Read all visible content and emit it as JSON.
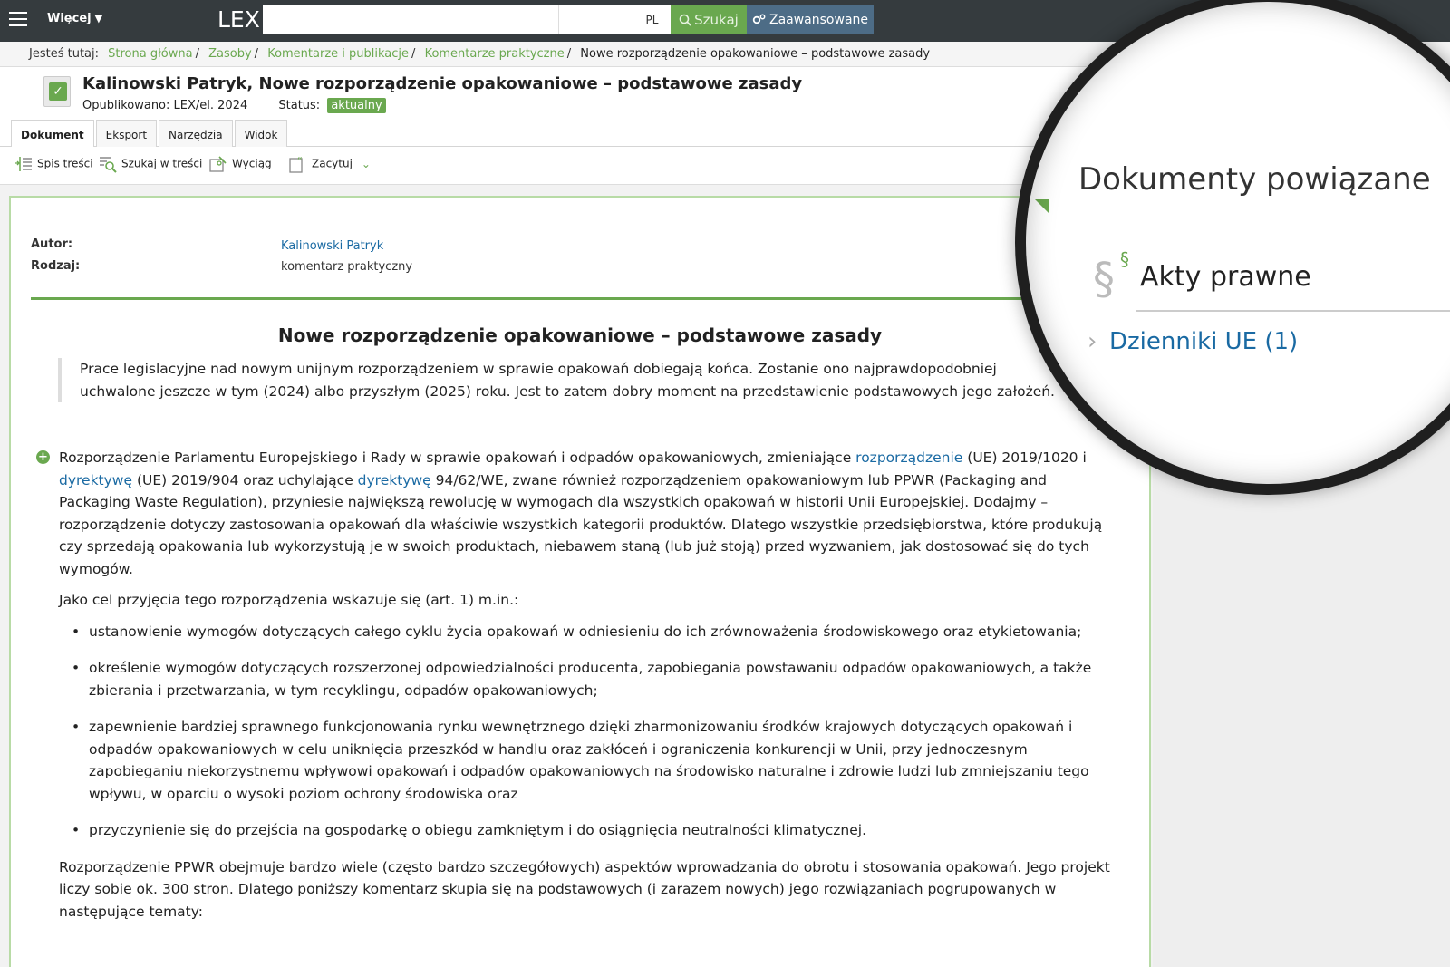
{
  "topbar": {
    "more_label": "Więcej",
    "logo": "LEX",
    "search_placeholder": "",
    "lang": "PL",
    "search_button": "Szukaj",
    "advanced_button": "Zaawansowane"
  },
  "breadcrumb": {
    "label": "Jesteś tutaj:",
    "items": [
      "Strona główna",
      "Zasoby",
      "Komentarze i publikacje",
      "Komentarze praktyczne"
    ],
    "current": "Nowe rozporządzenie opakowaniowe – podstawowe zasady"
  },
  "document": {
    "title": "Kalinowski Patryk, Nowe rozporządzenie opakowaniowe – podstawowe zasady",
    "published_label": "Opublikowano:",
    "published_value": "LEX/el. 2024",
    "status_label": "Status:",
    "status_value": "aktualny"
  },
  "tabs": [
    "Dokument",
    "Eksport",
    "Narzędzia",
    "Widok"
  ],
  "toolbar": {
    "toc": "Spis treści",
    "find": "Szukaj w treści",
    "extract": "Wyciąg",
    "cite": "Zacytuj"
  },
  "meta": {
    "author_label": "Autor:",
    "author_value": "Kalinowski Patryk",
    "type_label": "Rodzaj:",
    "type_value": "komentarz praktyczny"
  },
  "article": {
    "title": "Nowe rozporządzenie opakowaniowe – podstawowe zasady",
    "lead": "Prace legislacyjne nad nowym unijnym rozporządzeniem w sprawie opakowań dobiegają końca. Zostanie ono najprawdopodobniej uchwalone jeszcze w tym (2024) albo przyszłym (2025) roku. Jest to zatem dobry moment na przedstawienie podstawowych jego założeń.",
    "p1_a": "Rozporządzenie Parlamentu Europejskiego i Rady w sprawie opakowań i odpadów opakowaniowych, zmieniające ",
    "p1_link1": "rozporządzenie",
    "p1_b": " (UE) 2019/1020 i ",
    "p1_link2": "dyrektywę",
    "p1_c": " (UE) 2019/904 oraz uchylające ",
    "p1_link3": "dyrektywę",
    "p1_d": " 94/62/WE, zwane również rozporządzeniem opakowaniowym lub PPWR (Packaging and Packaging Waste Regulation), przyniesie największą rewolucję w wymogach dla wszystkich opakowań w historii Unii Europejskiej. Dodajmy – rozporządzenie dotyczy zastosowania opakowań dla właściwie wszystkich kategorii produktów. Dlatego wszystkie przedsiębiorstwa, które produkują czy sprzedają opakowania lub wykorzystują je w swoich produktach, niebawem staną (lub już stoją) przed wyzwaniem, jak dostosować się do tych wymogów.",
    "p2": "Jako cel przyjęcia tego rozporządzenia wskazuje się (art. 1) m.in.:",
    "bullets": [
      "ustanowienie wymogów dotyczących całego cyklu życia opakowań w odniesieniu do ich zrównoważenia środowiskowego oraz etykietowania;",
      "określenie wymogów dotyczących rozszerzonej odpowiedzialności producenta, zapobiegania powstawaniu odpadów opakowaniowych, a także zbierania i przetwarzania, w tym recyklingu, odpadów opakowaniowych;",
      "zapewnienie bardziej sprawnego funkcjonowania rynku wewnętrznego dzięki zharmonizowaniu środków krajowych dotyczących opakowań i odpadów opakowaniowych w celu uniknięcia przeszkód w handlu oraz zakłóceń i ograniczenia konkurencji w Unii, przy jednoczesnym zapobieganiu niekorzystnemu wpływowi opakowań i odpadów opakowaniowych na środowisko naturalne i zdrowie ludzi lub zmniejszaniu tego wpływu, w oparciu o wysoki poziom ochrony środowiska oraz",
      "przyczynienie się do przejścia na gospodarkę o obiegu zamkniętym i do osiągnięcia neutralności klimatycznej."
    ],
    "p3": "Rozporządzenie PPWR obejmuje bardzo wiele (często bardzo szczegółowych) aspektów wprowadzania do obrotu i stosowania opakowań. Jego projekt liczy sobie ok. 300 stron. Dlatego poniższy komentarz skupia się na podstawowych (i zarazem nowych) jego rozwiązaniach pogrupowanych w następujące tematy:"
  },
  "related": {
    "title": "Dokumenty powiązane",
    "section": "Akty prawne",
    "link": "Dzienniki UE (1)"
  },
  "colors": {
    "topbar": "#353b3e",
    "green": "#6aa84f",
    "link": "#1a6aa3",
    "advanced": "#4d6c86"
  }
}
